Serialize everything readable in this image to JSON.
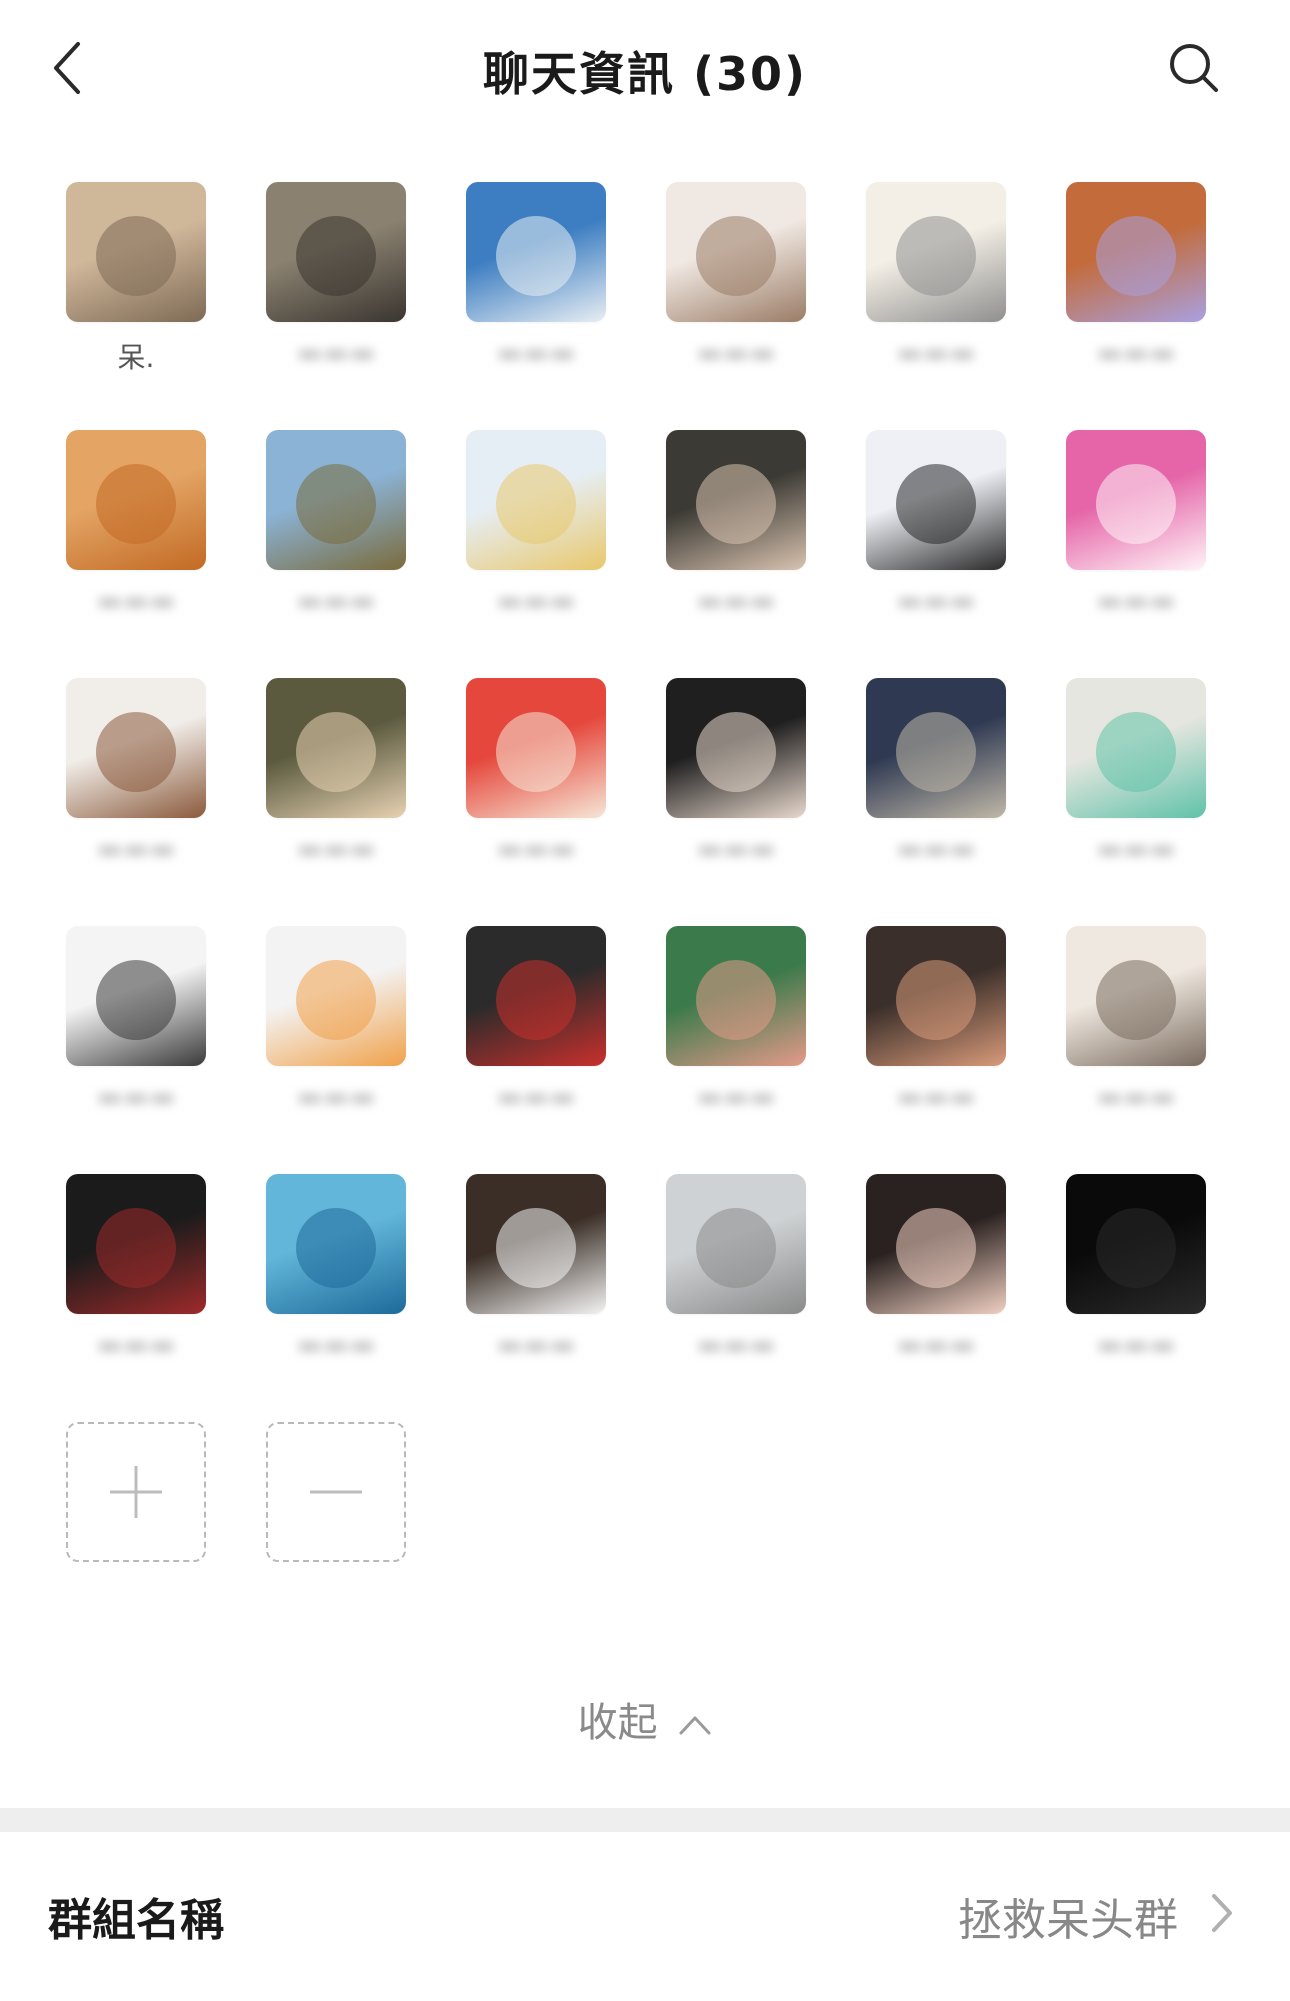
{
  "header": {
    "title": "聊天資訊 (30)"
  },
  "members": [
    {
      "name": "呆.",
      "blurred": false,
      "colors": [
        "#cfb79a",
        "#7e6a55"
      ]
    },
    {
      "name": "",
      "blurred": true,
      "colors": [
        "#8a8170",
        "#3a3530"
      ]
    },
    {
      "name": "",
      "blurred": true,
      "colors": [
        "#3d7ec2",
        "#e8eef3"
      ]
    },
    {
      "name": "",
      "blurred": true,
      "colors": [
        "#f0e8e2",
        "#9a7c66"
      ]
    },
    {
      "name": "",
      "blurred": true,
      "colors": [
        "#f4efe6",
        "#8f8f8f"
      ]
    },
    {
      "name": "",
      "blurred": true,
      "colors": [
        "#c36b3a",
        "#a9a0e0"
      ]
    },
    {
      "name": "",
      "blurred": true,
      "colors": [
        "#e3a464",
        "#c26a24"
      ]
    },
    {
      "name": "",
      "blurred": true,
      "colors": [
        "#8bb3d6",
        "#7a6b3c"
      ]
    },
    {
      "name": "",
      "blurred": true,
      "colors": [
        "#e6eef5",
        "#e8c86c"
      ]
    },
    {
      "name": "",
      "blurred": true,
      "colors": [
        "#3b3a34",
        "#d9c3b0"
      ]
    },
    {
      "name": "",
      "blurred": true,
      "colors": [
        "#eef0f5",
        "#2a2a2a"
      ]
    },
    {
      "name": "",
      "blurred": true,
      "colors": [
        "#e565a8",
        "#fff3f7"
      ]
    },
    {
      "name": "",
      "blurred": true,
      "colors": [
        "#f1ede8",
        "#8a5a3c"
      ]
    },
    {
      "name": "",
      "blurred": true,
      "colors": [
        "#5b5a3f",
        "#e7d2b2"
      ]
    },
    {
      "name": "",
      "blurred": true,
      "colors": [
        "#e5473c",
        "#f6e6d6"
      ]
    },
    {
      "name": "",
      "blurred": true,
      "colors": [
        "#1f1f1f",
        "#e8d8cc"
      ]
    },
    {
      "name": "",
      "blurred": true,
      "colors": [
        "#2f3a52",
        "#c0b8a8"
      ]
    },
    {
      "name": "",
      "blurred": true,
      "colors": [
        "#e6e6e0",
        "#5fc2a8"
      ]
    },
    {
      "name": "",
      "blurred": true,
      "colors": [
        "#f4f4f4",
        "#3a3a3a"
      ]
    },
    {
      "name": "",
      "blurred": true,
      "colors": [
        "#f3f3f3",
        "#f0a14a"
      ]
    },
    {
      "name": "",
      "blurred": true,
      "colors": [
        "#2b2b2b",
        "#c9302c"
      ]
    },
    {
      "name": "",
      "blurred": true,
      "colors": [
        "#3b7a4a",
        "#e49a8a"
      ]
    },
    {
      "name": "",
      "blurred": true,
      "colors": [
        "#3a2f2a",
        "#d99a7a"
      ]
    },
    {
      "name": "",
      "blurred": true,
      "colors": [
        "#efe8e0",
        "#7a6b5e"
      ]
    },
    {
      "name": "",
      "blurred": true,
      "colors": [
        "#1b1b1b",
        "#9e2a2a"
      ]
    },
    {
      "name": "",
      "blurred": true,
      "colors": [
        "#62b6d9",
        "#1d6a9a"
      ]
    },
    {
      "name": "",
      "blurred": true,
      "colors": [
        "#3a2e26",
        "#f4f4f4"
      ]
    },
    {
      "name": "",
      "blurred": true,
      "colors": [
        "#cfd2d4",
        "#8a8a8a"
      ]
    },
    {
      "name": "",
      "blurred": true,
      "colors": [
        "#2a2220",
        "#f0d0c2"
      ]
    },
    {
      "name": "",
      "blurred": true,
      "colors": [
        "#0a0a0a",
        "#2a2a2a"
      ]
    }
  ],
  "collapse": {
    "label": "收起"
  },
  "group_name": {
    "label": "群組名稱",
    "value": "拯救呆头群"
  },
  "icons": {
    "back": "back-chevron-icon",
    "search": "search-icon",
    "add": "plus-icon",
    "remove": "minus-icon",
    "collapse": "chevron-up-icon",
    "row": "chevron-right-icon"
  }
}
